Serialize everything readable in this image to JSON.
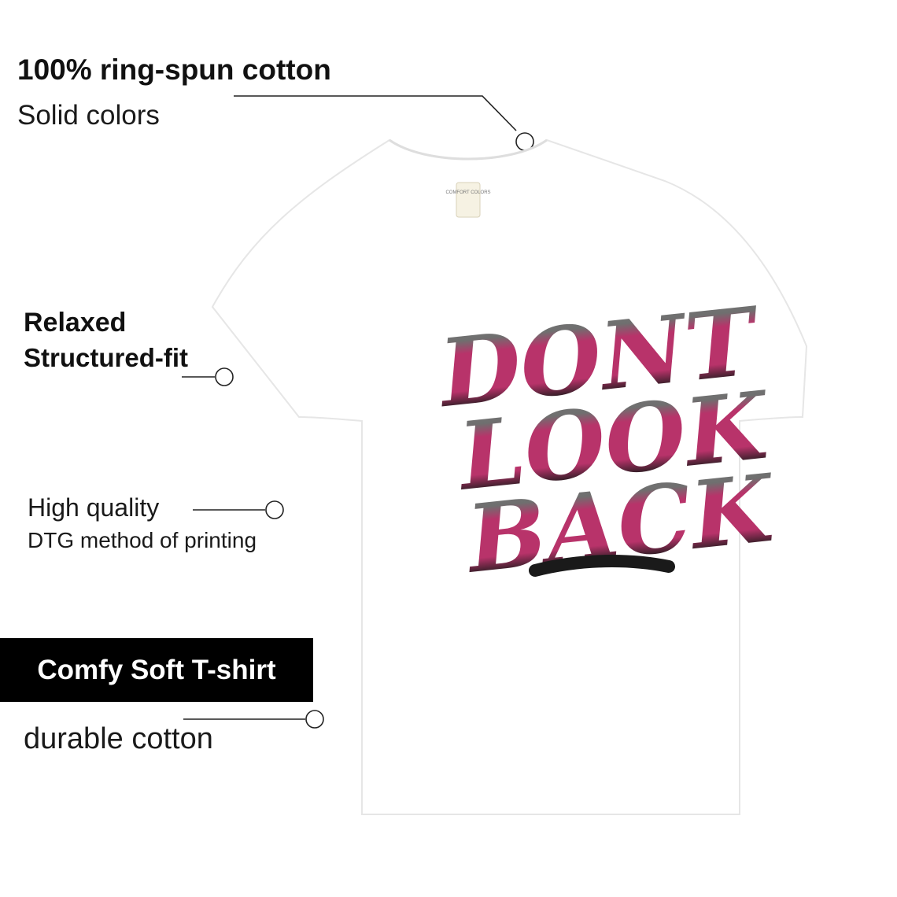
{
  "features": [
    {
      "title": "100% ring-spun cotton",
      "subtitle": "Solid colors"
    },
    {
      "title": "Relaxed",
      "subtitle": "Structured-fit"
    },
    {
      "title": "High quality",
      "subtitle": "DTG method of printing"
    },
    {
      "title": "Comfy Soft T-shirt",
      "subtitle": "durable cotton"
    }
  ],
  "print": {
    "lines": [
      "DONT",
      "LOOK",
      "BACK"
    ],
    "colors": {
      "top": "#777777",
      "middle": "#b8336a",
      "bottom": "#1a1a1a"
    }
  },
  "tag_text": "COMFORT COLORS",
  "colors": {
    "badge_bg": "#000000",
    "badge_text": "#ffffff",
    "shirt": "#ffffff",
    "shirt_outline": "#e6e6e6"
  }
}
